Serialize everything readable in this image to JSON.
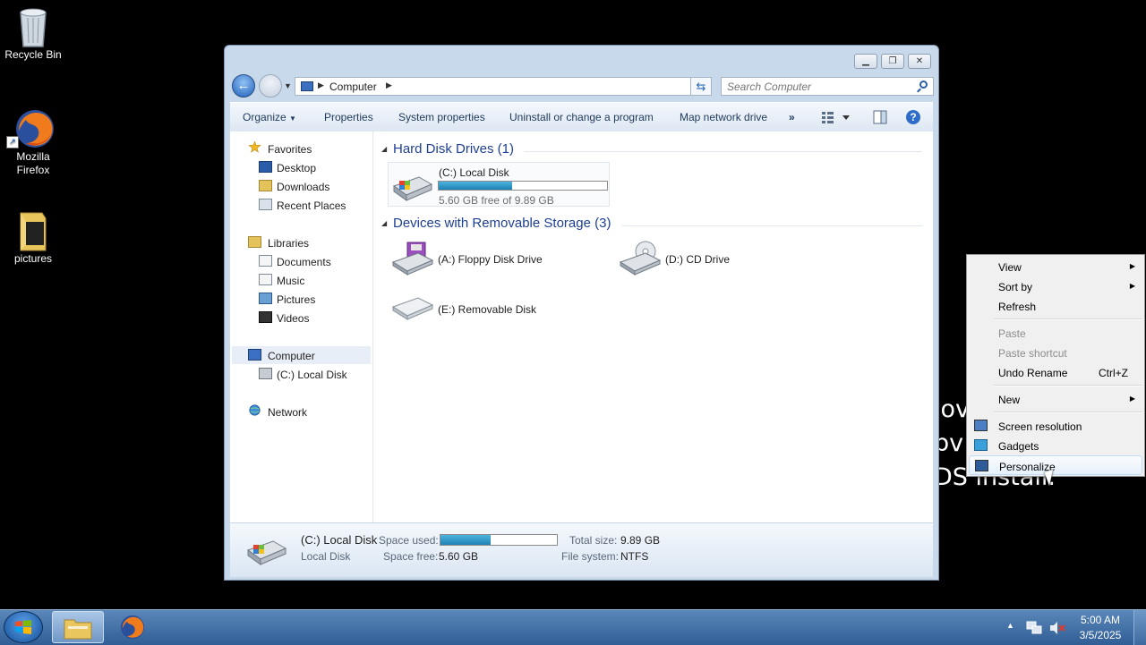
{
  "desktop": {
    "icons": [
      {
        "label": "Recycle Bin"
      },
      {
        "label": "Mozilla Firefox"
      },
      {
        "label": "pictures"
      }
    ],
    "background_text": [
      "lov",
      "bv",
      "DS install."
    ]
  },
  "explorer": {
    "address": {
      "crumb": "Computer"
    },
    "search": {
      "placeholder": "Search Computer"
    },
    "toolbar": {
      "organize": "Organize",
      "properties": "Properties",
      "system_properties": "System properties",
      "uninstall": "Uninstall or change a program",
      "map_drive": "Map network drive",
      "more": "»"
    },
    "nav": {
      "favorites": "Favorites",
      "desktop": "Desktop",
      "downloads": "Downloads",
      "recent": "Recent Places",
      "libraries": "Libraries",
      "documents": "Documents",
      "music": "Music",
      "pictures": "Pictures",
      "videos": "Videos",
      "computer": "Computer",
      "local_disk": "(C:) Local Disk",
      "network": "Network"
    },
    "groups": {
      "hdd": {
        "title": "Hard Disk Drives (1)",
        "drives": [
          {
            "name": "(C:) Local Disk",
            "free_text": "5.60 GB free of 9.89 GB",
            "used_fraction": 0.434
          }
        ]
      },
      "removable": {
        "title": "Devices with Removable Storage (3)",
        "drives": [
          {
            "name": "(A:) Floppy Disk Drive"
          },
          {
            "name": "(D:) CD Drive"
          },
          {
            "name": "(E:) Removable Disk"
          }
        ]
      }
    },
    "details": {
      "name": "(C:) Local Disk",
      "type": "Local Disk",
      "space_used_label": "Space used:",
      "space_free_label": "Space free:",
      "space_free": "5.60 GB",
      "total_size_label": "Total size:",
      "total_size": "9.89 GB",
      "file_system_label": "File system:",
      "file_system": "NTFS",
      "used_fraction": 0.434
    }
  },
  "context_menu": {
    "view": "View",
    "sort_by": "Sort by",
    "refresh": "Refresh",
    "paste": "Paste",
    "paste_shortcut": "Paste shortcut",
    "undo_rename": "Undo Rename",
    "undo_shortcut": "Ctrl+Z",
    "new": "New",
    "screen_resolution": "Screen resolution",
    "gadgets": "Gadgets",
    "personalize": "Personalize"
  },
  "taskbar": {
    "time": "5:00 AM",
    "date": "3/5/2025"
  },
  "colors": {
    "accent": "#1e3f92",
    "taskbar": "#3d6aa3",
    "capacity_fill": "#2a8fc1"
  }
}
